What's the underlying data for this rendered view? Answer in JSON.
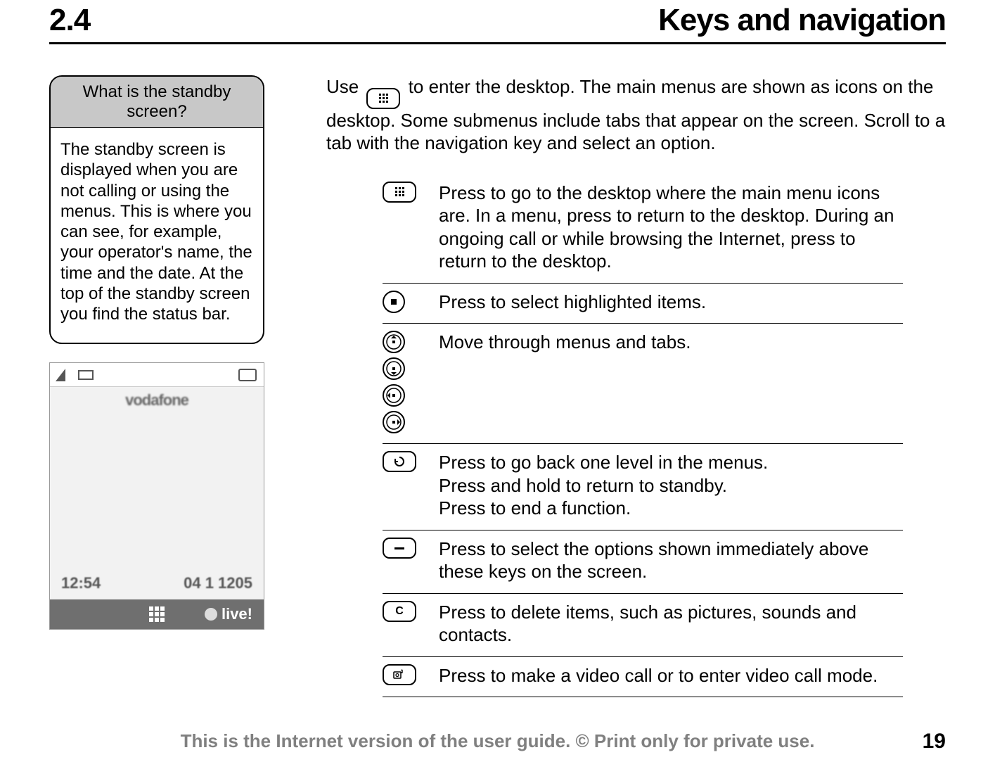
{
  "header": {
    "section_number": "2.4",
    "title": "Keys and navigation"
  },
  "callout": {
    "title": "What is the standby screen?",
    "body": "The standby screen is displayed when you are not calling or using the menus. This is where you can see, for example, your operator's name, the time and the date. At the top of the standby screen you find the status bar."
  },
  "screenshot": {
    "operator": "vodafone",
    "time": "12:54",
    "date": "04 1 1205",
    "softkey_right": "live!"
  },
  "intro": {
    "before_key": "Use ",
    "after_key": " to enter the desktop. The main menus are shown as icons on the desktop. Some submenus include tabs that appear on the screen. Scroll to a tab with the navigation key and select an option."
  },
  "rows": [
    {
      "icons": [
        "grid-key"
      ],
      "desc": "Press to go to the desktop where the main menu icons are. In a menu, press to return to the desktop. During an ongoing call or while browsing the Internet, press to return to the desktop."
    },
    {
      "icons": [
        "select-key"
      ],
      "desc": "Press to select highlighted items."
    },
    {
      "icons": [
        "nav-up",
        "nav-down",
        "nav-left",
        "nav-right"
      ],
      "desc": "Move through menus and tabs."
    },
    {
      "icons": [
        "back-key"
      ],
      "desc": "Press to go back one level in the menus.\nPress and hold to return to standby.\nPress to end a function."
    },
    {
      "icons": [
        "soft-key"
      ],
      "desc": "Press to select the options shown immediately above these keys on the screen."
    },
    {
      "icons": [
        "c-key"
      ],
      "desc": "Press to delete items, such as pictures, sounds and contacts."
    },
    {
      "icons": [
        "video-key"
      ],
      "desc": "Press to make a video call or to enter video call mode."
    }
  ],
  "footer": "This is the Internet version of the user guide. © Print only for private use.",
  "page_number": "19"
}
